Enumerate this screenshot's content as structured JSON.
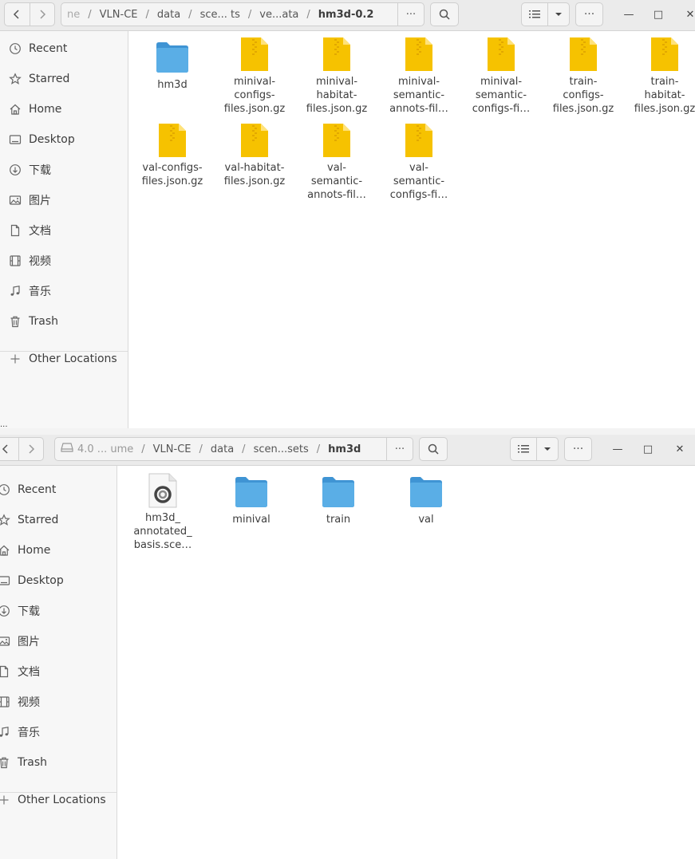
{
  "window1": {
    "path": [
      {
        "label": "ne"
      },
      {
        "label": "VLN-CE"
      },
      {
        "label": "data"
      },
      {
        "label": "sce... ts"
      },
      {
        "label": "ve...ata"
      },
      {
        "label": "hm3d-0.2"
      }
    ],
    "path_more": "···",
    "menu_more": "···",
    "window_controls": {
      "minimize": "—",
      "maximize": "□",
      "close": "✕"
    },
    "sidebar": [
      {
        "label": "Recent",
        "icon": "clock-icon"
      },
      {
        "label": "Starred",
        "icon": "star-icon"
      },
      {
        "label": "Home",
        "icon": "home-icon"
      },
      {
        "label": "Desktop",
        "icon": "desktop-icon"
      },
      {
        "label": "下载",
        "icon": "download-icon"
      },
      {
        "label": "图片",
        "icon": "pictures-icon"
      },
      {
        "label": "文档",
        "icon": "document-icon"
      },
      {
        "label": "视频",
        "icon": "video-icon"
      },
      {
        "label": "音乐",
        "icon": "music-icon"
      },
      {
        "label": "Trash",
        "icon": "trash-icon"
      },
      {
        "label": "Other Locations",
        "icon": "plus-icon"
      }
    ],
    "files": [
      {
        "name": "hm3d",
        "type": "folder"
      },
      {
        "name": "minival-configs-files.json.gz",
        "type": "archive",
        "lines": [
          "minival-",
          "configs-",
          "files.json.gz"
        ]
      },
      {
        "name": "minival-habitat-files.json.gz",
        "type": "archive",
        "lines": [
          "minival-",
          "habitat-",
          "files.json.gz"
        ]
      },
      {
        "name": "minival-semantic-annots-fil…",
        "type": "archive",
        "lines": [
          "minival-",
          "semantic-",
          "annots-fil…"
        ]
      },
      {
        "name": "minival-semantic-configs-fi…",
        "type": "archive",
        "lines": [
          "minival-",
          "semantic-",
          "configs-fi…"
        ]
      },
      {
        "name": "train-configs-files.json.gz",
        "type": "archive",
        "lines": [
          "train-",
          "configs-",
          "files.json.gz"
        ]
      },
      {
        "name": "train-habitat-files.json.gz",
        "type": "archive",
        "lines": [
          "train-",
          "habitat-",
          "files.json.gz"
        ]
      },
      {
        "name": "val-configs-files.json.gz",
        "type": "archive",
        "lines": [
          "val-configs-",
          "files.json.gz"
        ]
      },
      {
        "name": "val-habitat-files.json.gz",
        "type": "archive",
        "lines": [
          "val-habitat-",
          "files.json.gz"
        ]
      },
      {
        "name": "val-semantic-annots-fil…",
        "type": "archive",
        "lines": [
          "val-",
          "semantic-",
          "annots-fil…"
        ]
      },
      {
        "name": "val-semantic-configs-fi…",
        "type": "archive",
        "lines": [
          "val-",
          "semantic-",
          "configs-fi…"
        ]
      }
    ]
  },
  "gap_text": "...",
  "window2": {
    "path": [
      {
        "label": "4.0 ... ume"
      },
      {
        "label": "VLN-CE"
      },
      {
        "label": "data"
      },
      {
        "label": "scen...sets"
      },
      {
        "label": "hm3d"
      }
    ],
    "path_more": "···",
    "menu_more": "···",
    "window_controls": {
      "minimize": "—",
      "maximize": "□",
      "close": "✕"
    },
    "sidebar": [
      {
        "label": "Recent",
        "icon": "clock-icon"
      },
      {
        "label": "Starred",
        "icon": "star-icon"
      },
      {
        "label": "Home",
        "icon": "home-icon"
      },
      {
        "label": "Desktop",
        "icon": "desktop-icon"
      },
      {
        "label": "下载",
        "icon": "download-icon"
      },
      {
        "label": "图片",
        "icon": "pictures-icon"
      },
      {
        "label": "文档",
        "icon": "document-icon"
      },
      {
        "label": "视频",
        "icon": "video-icon"
      },
      {
        "label": "音乐",
        "icon": "music-icon"
      },
      {
        "label": "Trash",
        "icon": "trash-icon"
      },
      {
        "label": "Other Locations",
        "icon": "plus-icon"
      }
    ],
    "files": [
      {
        "name": "hm3d_annotated_basis.sce…",
        "type": "scene-file",
        "lines": [
          "hm3d_",
          "annotated_",
          "basis.sce…"
        ]
      },
      {
        "name": "minival",
        "type": "folder"
      },
      {
        "name": "train",
        "type": "folder"
      },
      {
        "name": "val",
        "type": "folder"
      }
    ]
  },
  "colors": {
    "folder": "#5aaee6",
    "archive": "#f6c200",
    "headerbar": "#ebebeb",
    "sidebar": "#f7f7f7"
  }
}
